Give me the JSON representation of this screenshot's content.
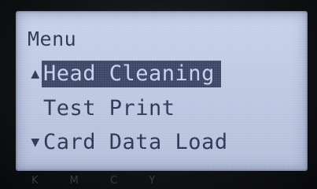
{
  "menu": {
    "title": "Menu",
    "items": [
      {
        "label": "Head Cleaning",
        "marker": "▲",
        "selected": true
      },
      {
        "label": "Test Print",
        "marker": "",
        "selected": false
      },
      {
        "label": "Card Data Load",
        "marker": "▼",
        "selected": false
      }
    ]
  },
  "keys": {
    "labels": "K M C Y"
  },
  "colors": {
    "lcd_background": "#c7d2ea",
    "lcd_text": "#2e3552",
    "highlight_background": "#3c4565",
    "bezel": "#111215"
  }
}
